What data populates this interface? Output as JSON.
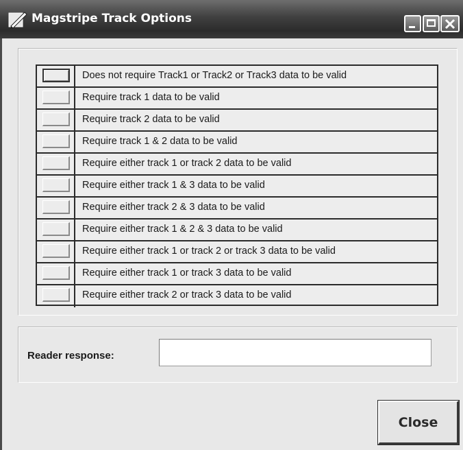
{
  "window": {
    "title": "Magstripe Track Options",
    "title_icon": "pencil-icon"
  },
  "titlebar_buttons": {
    "minimize_icon": "minimize-icon",
    "maximize_icon": "maximize-icon",
    "close_icon": "close-icon"
  },
  "options": [
    {
      "label": "Does not require Track1 or Track2 or Track3  data to be valid"
    },
    {
      "label": "Require track 1  data to be valid"
    },
    {
      "label": "Require track 2 data to be valid"
    },
    {
      "label": "Require track 1 & 2 data to be valid"
    },
    {
      "label": "Require either track 1 or track 2 data to be valid"
    },
    {
      "label": "Require either track 1 & 3 data to be valid"
    },
    {
      "label": "Require either track 2 & 3 data to be valid"
    },
    {
      "label": "Require either track 1 &  2 & 3 data to be valid"
    },
    {
      "label": "Require either track 1 or track 2 or track 3 data to be valid"
    },
    {
      "label": "Require either track 1 or track 3 data to be valid"
    },
    {
      "label": "Require either track 2 or track 3 data to be valid"
    }
  ],
  "response": {
    "label": "Reader response:",
    "value": ""
  },
  "footer": {
    "close_label": "Close"
  }
}
